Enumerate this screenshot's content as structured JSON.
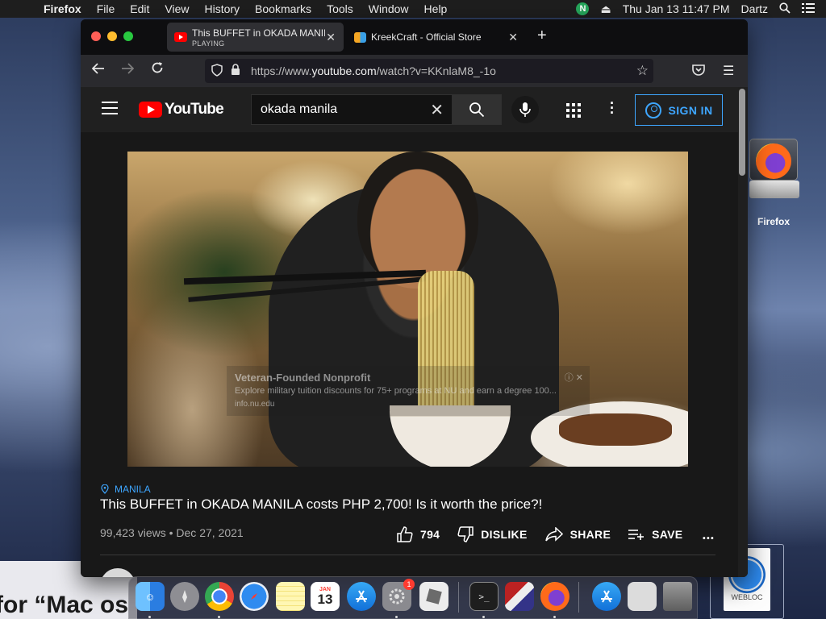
{
  "menubar": {
    "app": "Firefox",
    "items": [
      "File",
      "Edit",
      "View",
      "History",
      "Bookmarks",
      "Tools",
      "Window",
      "Help"
    ],
    "clock": "Thu Jan 13  11:47 PM",
    "user": "Dartz",
    "status_icon_letter": "N"
  },
  "browser": {
    "tabs": [
      {
        "title": "This BUFFET in OKADA MANILA",
        "subtitle": "PLAYING",
        "active": true
      },
      {
        "title": "KreekCraft - Official Store",
        "subtitle": "",
        "active": false
      }
    ],
    "url_prefix": "https://www.",
    "url_domain": "youtube.com",
    "url_path": "/watch?v=KKnlaM8_-1o"
  },
  "youtube": {
    "logo_text": "YouTube",
    "search_value": "okada manila",
    "sign_in_label": "SIGN IN",
    "video": {
      "ad": {
        "title": "Veteran-Founded Nonprofit",
        "description": "Explore military tuition discounts for 75+ programs at NU and earn a degree 100...",
        "url": "info.nu.edu"
      },
      "hashtag": "MANILA",
      "title": "This BUFFET in OKADA MANILA costs PHP 2,700! Is it worth the price?!",
      "views": "99,423 views",
      "date": "Dec 27, 2021",
      "separator": " • ",
      "likes": "794",
      "dislike_label": "DISLIKE",
      "share_label": "SHARE",
      "save_label": "SAVE",
      "more_label": "..."
    }
  },
  "desktop": {
    "firefox_label": "Firefox",
    "webloc_label": "WEBLOC",
    "bottom_text": "for “Mac os"
  },
  "dock": {
    "calendar_month": "JAN",
    "calendar_day": "13",
    "sysprefs_badge": "1"
  },
  "colors": {
    "youtube_red": "#ff0000",
    "link_blue": "#3ea6ff",
    "page_bg": "#181818"
  }
}
